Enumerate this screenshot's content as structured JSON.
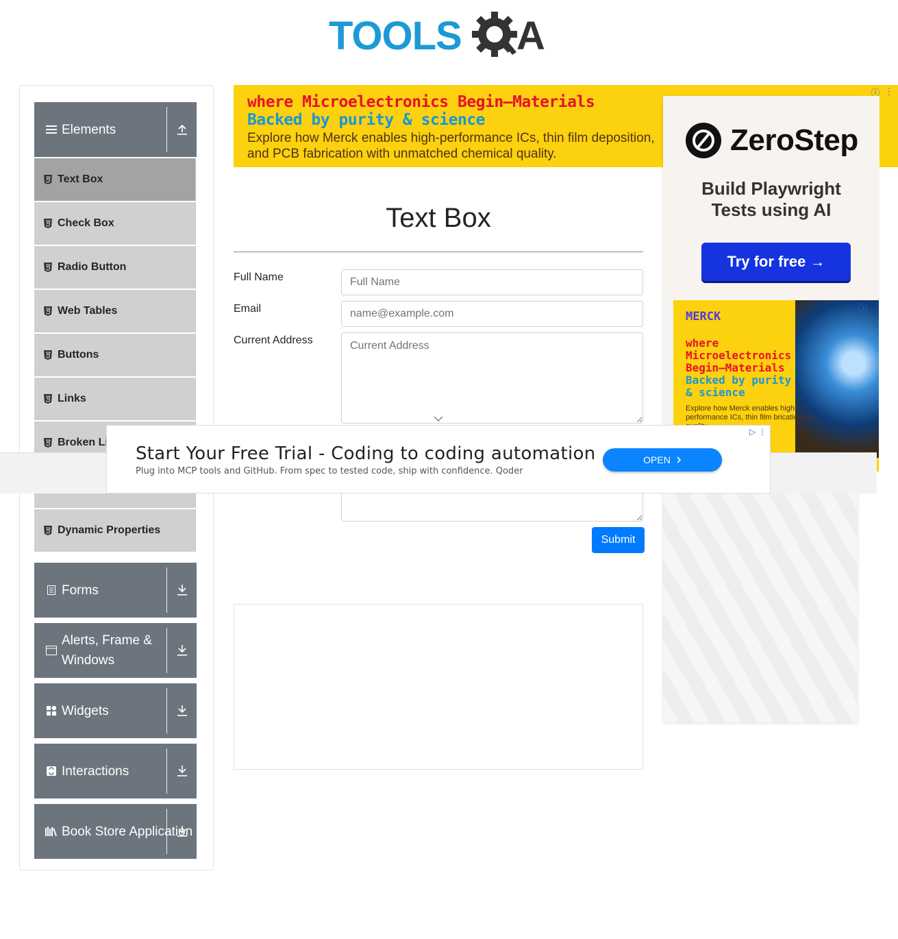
{
  "header": {
    "logo_text_left": "TOOLS",
    "logo_text_right": "A"
  },
  "sidebar": {
    "groups": [
      {
        "label": "Elements",
        "icon": "hamburger-icon",
        "arrow": "collapse-up-icon"
      },
      {
        "label": "Forms",
        "icon": "document-icon",
        "arrow": "expand-down-icon"
      },
      {
        "label": "Alerts, Frame & Windows",
        "icon": "window-icon",
        "arrow": "expand-down-icon"
      },
      {
        "label": "Widgets",
        "icon": "widgets-icon",
        "arrow": "expand-down-icon"
      },
      {
        "label": "Interactions",
        "icon": "interactions-icon",
        "arrow": "expand-down-icon"
      },
      {
        "label": "Book Store Application",
        "icon": "books-icon",
        "arrow": "expand-down-icon"
      }
    ],
    "items": [
      {
        "label": "Text Box",
        "active": true
      },
      {
        "label": "Check Box"
      },
      {
        "label": "Radio Button"
      },
      {
        "label": "Web Tables"
      },
      {
        "label": "Buttons"
      },
      {
        "label": "Links"
      },
      {
        "label": "Broken Li"
      },
      {
        "label": "Dynamic Properties"
      }
    ]
  },
  "top_banner": {
    "line1": "where Microelectronics Begin—Materials",
    "line2": "Backed by purity & science",
    "body": "Explore how Merck enables high-performance ICs, thin film deposition, and PCB fabrication with unmatched chemical quality."
  },
  "main": {
    "title": "Text Box",
    "fields": {
      "full_name_label": "Full Name",
      "full_name_placeholder": "Full Name",
      "email_label": "Email",
      "email_placeholder": "name@example.com",
      "address_label": "Current Address",
      "address_placeholder": "Current Address"
    },
    "submit_label": "Submit"
  },
  "right_ad": {
    "brand": "ZeroStep",
    "tagline_1": "Build Playwright",
    "tagline_2": "Tests using AI",
    "cta": "Try for free →"
  },
  "merck_ad": {
    "logo": "MERCK",
    "h1": "where",
    "h2": "Microelectronics",
    "h3": "Begin—Materials",
    "h4": "Backed by purity",
    "h5": "& science",
    "body": "Explore how Merck enables high-performance ICs, thin film brication cal quality."
  },
  "overlay_ad": {
    "title": "Start Your Free Trial - Coding to coding automation",
    "subtitle": "Plug into MCP tools and GitHub. From spec to tested code, ship with confidence. Qoder",
    "button": "OPEN"
  },
  "colors": {
    "accent": "#007bff",
    "sidebar_header": "#6c757d",
    "sidebar_item": "#d0d0d0",
    "sidebar_item_active": "#a3a3a3",
    "logo_blue": "#1c9ad6",
    "logo_dark": "#333333"
  }
}
